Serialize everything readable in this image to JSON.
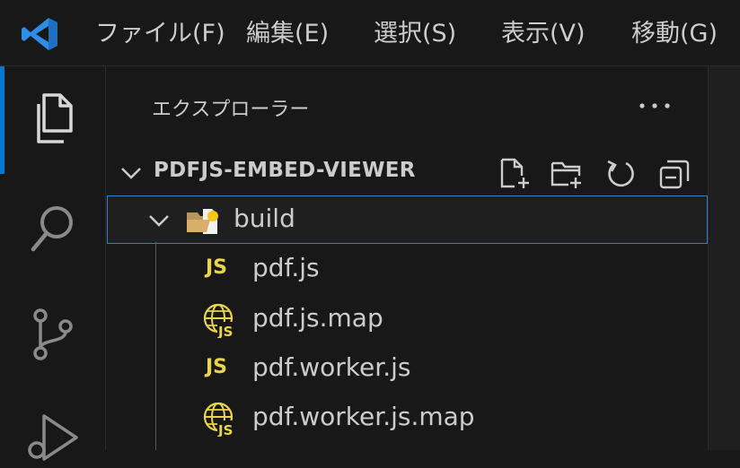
{
  "menu": {
    "items": [
      "ファイル(F)",
      "編集(E)",
      "選択(S)",
      "表示(V)",
      "移動(G)"
    ]
  },
  "sidebar": {
    "title": "エクスプローラー",
    "section": {
      "title": "PDFJS-EMBED-VIEWER"
    },
    "tree": [
      {
        "label": "build",
        "type": "folder",
        "expanded": true
      },
      {
        "label": "pdf.js",
        "type": "js",
        "badge": "JS"
      },
      {
        "label": "pdf.js.map",
        "type": "map",
        "badge": "JS"
      },
      {
        "label": "pdf.worker.js",
        "type": "js",
        "badge": "JS"
      },
      {
        "label": "pdf.worker.js.map",
        "type": "map",
        "badge": "JS"
      }
    ]
  },
  "colors": {
    "accent": "#0078d4",
    "js_yellow": "#e8d44d",
    "selection_border": "#2f7fd6"
  }
}
